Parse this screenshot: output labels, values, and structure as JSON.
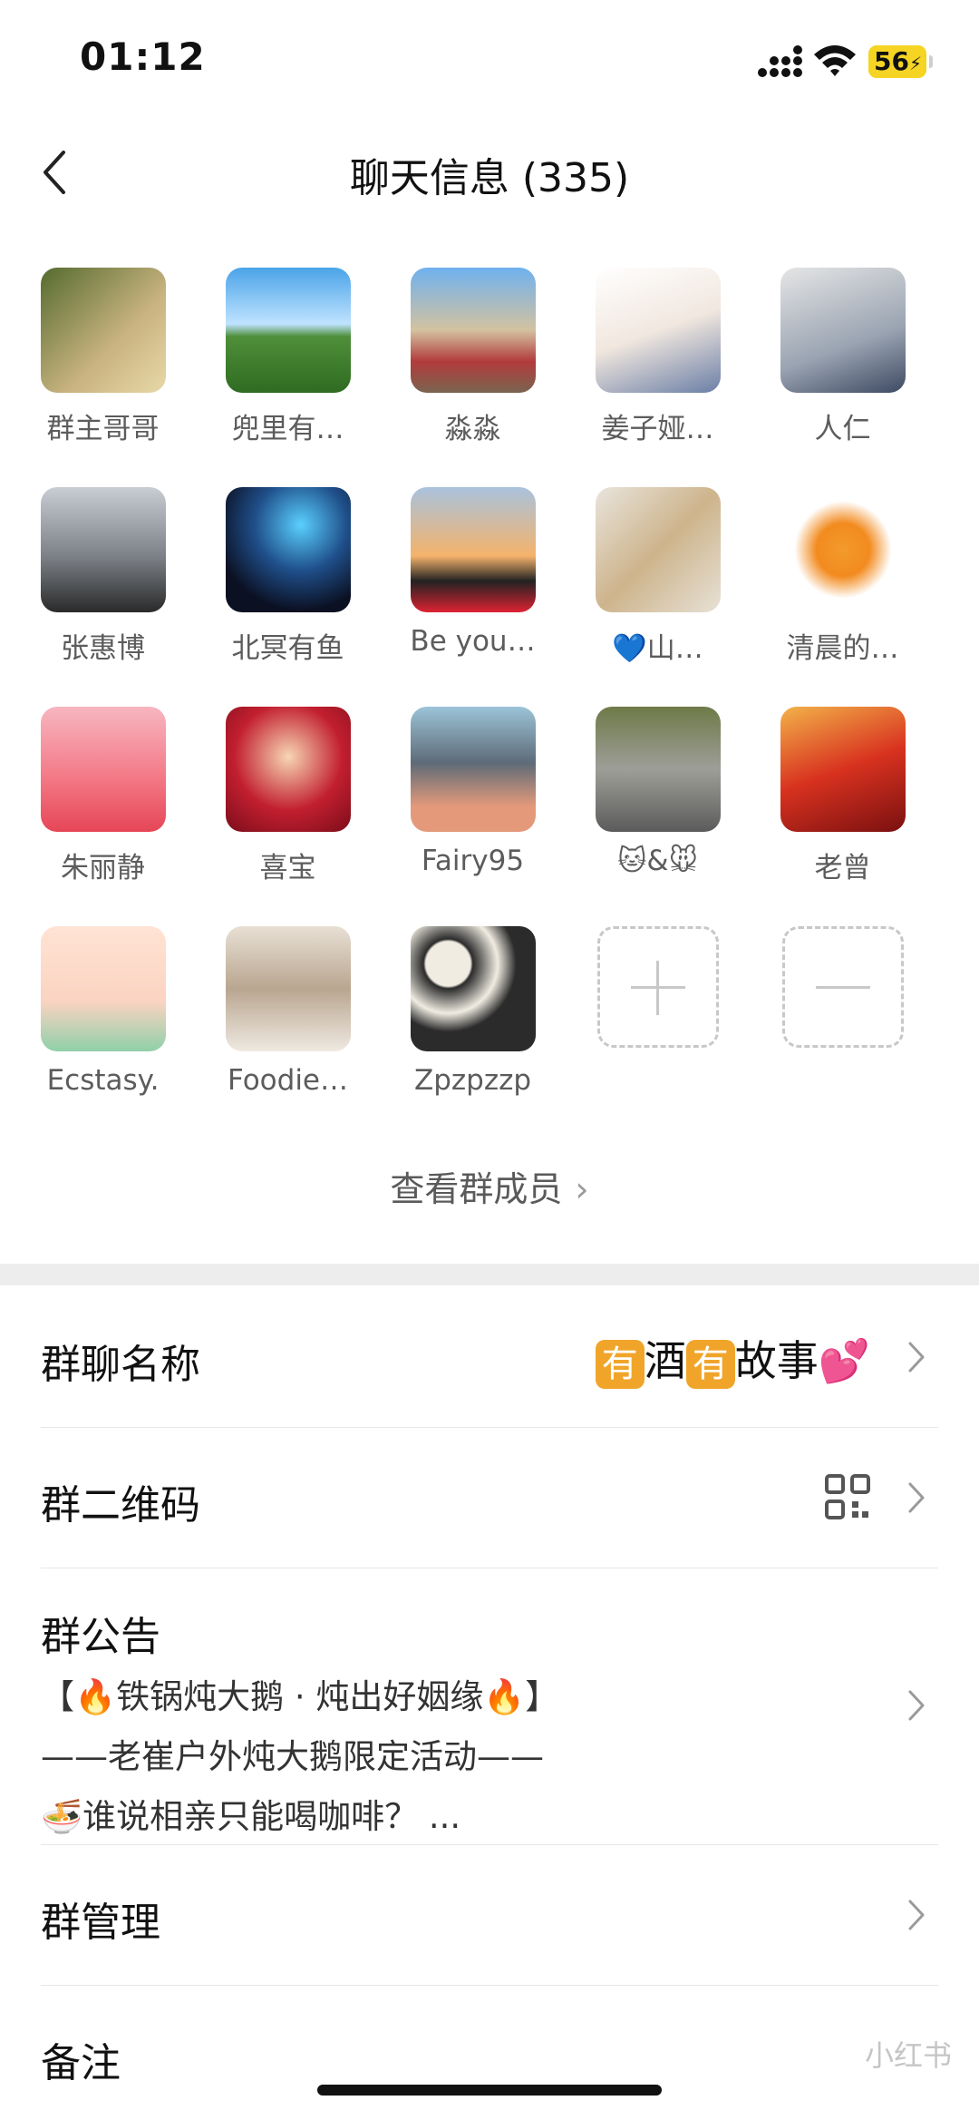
{
  "status_bar": {
    "time": "01:12",
    "battery": "56"
  },
  "header": {
    "title": "聊天信息 (335)"
  },
  "members": [
    {
      "name": "群主哥哥",
      "bg": "linear-gradient(135deg,#556b2f,#c9b380 60%,#e8d9a8)"
    },
    {
      "name": "兜里有…",
      "bg": "linear-gradient(180deg,#4aa3e8 0%,#bfe3ff 45%,#4f8f3a 55%,#2f6b21 100%)"
    },
    {
      "name": "淼淼",
      "bg": "linear-gradient(180deg,#6fb1ef 0%,#d3c2a0 50%,#b23b3b 75%,#7a6450 100%)"
    },
    {
      "name": "姜子娅…",
      "bg": "linear-gradient(160deg,#ffffff,#f1e7df 50%,#6b7fa6)"
    },
    {
      "name": "人仁",
      "bg": "linear-gradient(160deg,#e5e5e5,#9aa4b2 60%,#3e4a63)"
    },
    {
      "name": "张惠博",
      "bg": "linear-gradient(180deg,#c9ced3,#7d8288 55%,#2a2a2a)"
    },
    {
      "name": "北冥有鱼",
      "bg": "radial-gradient(circle at 60% 30%,#5ad0ff,#1f4f8a 40%,#0b1022 75%)"
    },
    {
      "name": "Be you…",
      "bg": "linear-gradient(180deg,#a9c2dd 0%,#f4b36b 55%,#222 75%,#d23 100%)"
    },
    {
      "name": "💙山…",
      "bg": "linear-gradient(135deg,#e9e4dc,#cdb48c 50%,#e7e1d6)"
    },
    {
      "name": "清晨的…",
      "bg": "radial-gradient(circle at 50% 50%,#f39a2c 0%,#f28b1f 30%,#ffffff 55%)"
    },
    {
      "name": "朱丽静",
      "bg": "linear-gradient(180deg,#f7b6c0,#f47b88 55%,#e64656)"
    },
    {
      "name": "喜宝",
      "bg": "radial-gradient(circle at 50% 40%,#f7d6b4,#c21f2f 55%,#7b0d1b)"
    },
    {
      "name": "Fairy95",
      "bg": "linear-gradient(180deg,#9bc4d8,#5e6b78 45%,#e49a7a 80%)"
    },
    {
      "name": "🐱&🐭",
      "bg": "linear-gradient(180deg,#6e7a48,#9e9e98 50%,#5b5b5b)"
    },
    {
      "name": "老曾",
      "bg": "linear-gradient(160deg,#f3b24a,#d8321f 50%,#7a1010)"
    },
    {
      "name": "Ecstasy.",
      "bg": "linear-gradient(180deg,#ffe3d4,#fbd3c2 60%,#8fd0a8)"
    },
    {
      "name": "Foodie…",
      "bg": "linear-gradient(180deg,#e8e0d4,#b9a690 50%,#efe9e1)"
    },
    {
      "name": "Zpzpzzp",
      "bg": "radial-gradient(circle at 30% 30%,#f0ece2 18%,#2b2b2b 20%,#f0ece2 40%,#2b2b2b 55%)"
    }
  ],
  "view_all": "查看群成员",
  "rows": {
    "group_name_label": "群聊名称",
    "group_name_tag1": "有",
    "group_name_text1": "酒",
    "group_name_tag2": "有",
    "group_name_text2": "故事💕",
    "qr_label": "群二维码",
    "notice_label": "群公告",
    "notice_line1": "【🔥铁锅炖大鹅 · 炖出好姻缘🔥】",
    "notice_line2": "——老崔户外炖大鹅限定活动——",
    "notice_line3": "🍜谁说相亲只能喝咖啡？ ...",
    "manage_label": "群管理",
    "remark_label": "备注"
  },
  "watermark": "小红书"
}
